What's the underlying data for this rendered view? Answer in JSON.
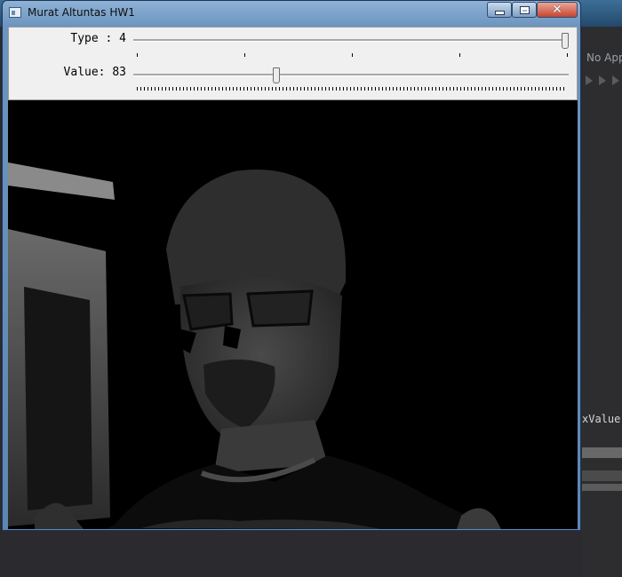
{
  "window": {
    "title": "Murat Altuntas HW1",
    "minimize_glyph": "minimize",
    "maximize_glyph": "maximize",
    "close_glyph": "✕"
  },
  "trackbars": [
    {
      "label": "Type : 4",
      "value": 4,
      "max": 4,
      "fraction": 1.0
    },
    {
      "label": "Value: 83",
      "value": 83,
      "max": 255,
      "fraction": 0.3255
    }
  ],
  "image": {
    "description_icon": "webcam-threshold-frame"
  },
  "background": {
    "partial_text": "No App",
    "code_text": "xValue"
  },
  "colors": {
    "title_bar": "#6c95c0",
    "close_button": "#c8452f",
    "control_panel": "#f0f0f0",
    "image_bg": "#000000"
  }
}
